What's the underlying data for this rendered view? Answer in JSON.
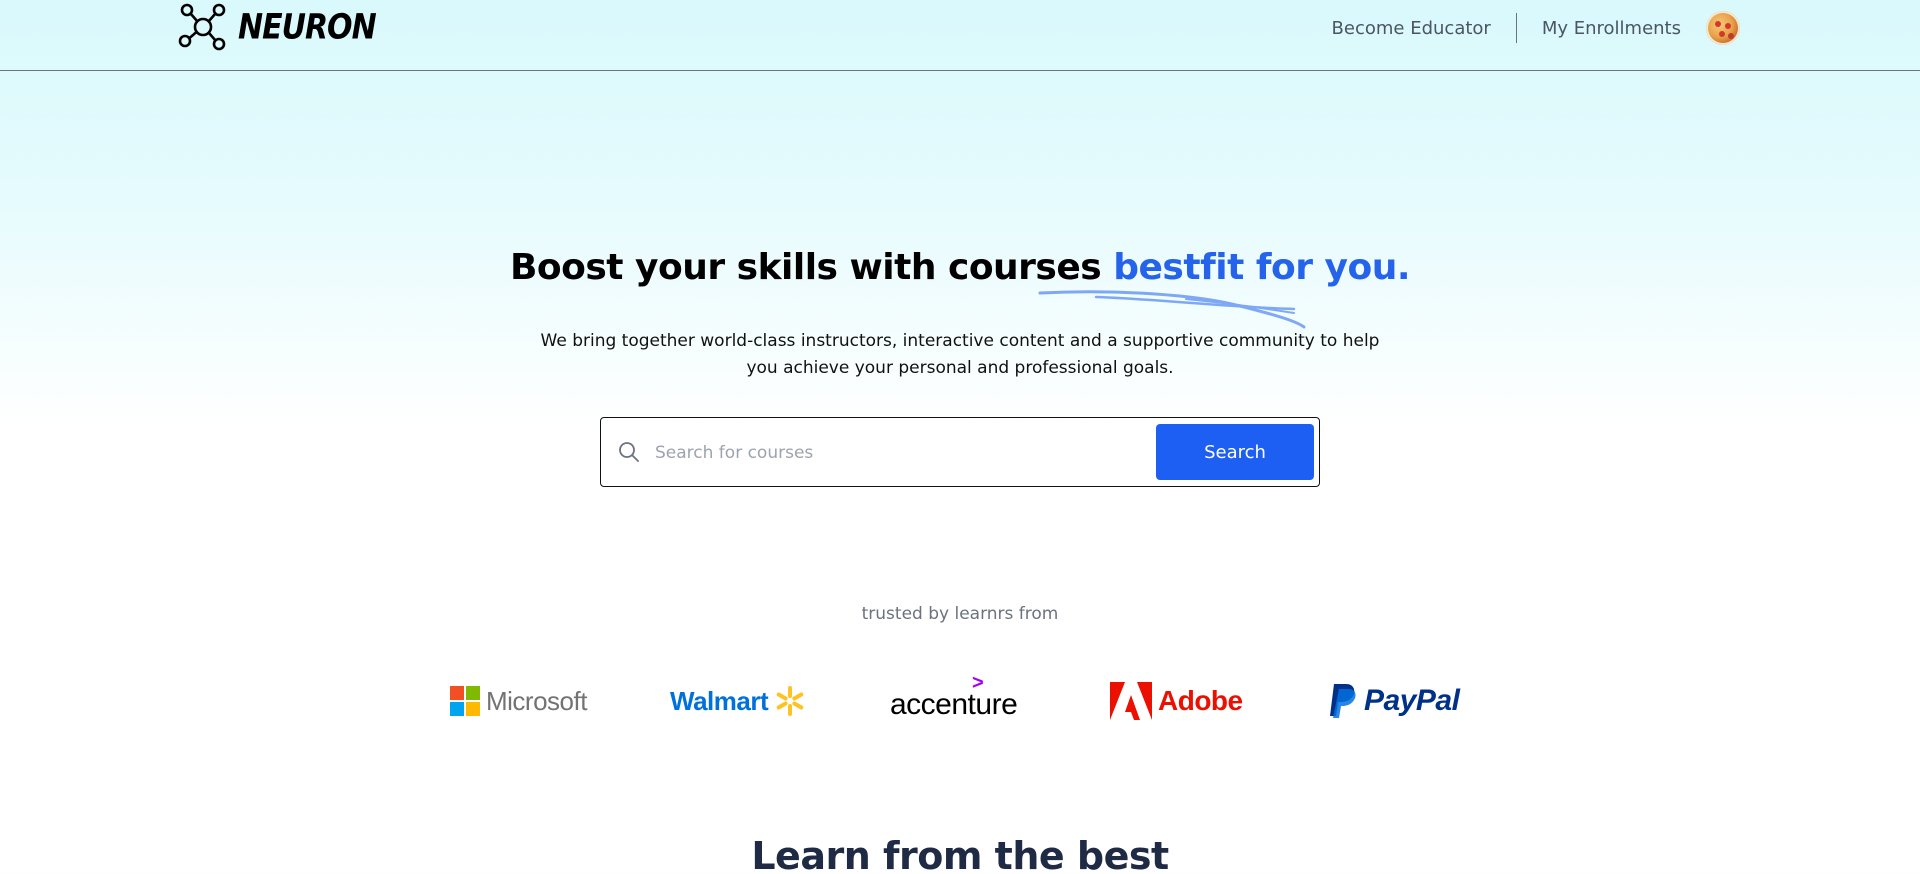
{
  "header": {
    "logo_text": "NEURON",
    "nav": {
      "become_educator": "Become Educator",
      "my_enrollments": "My Enrollments"
    }
  },
  "hero": {
    "title_main": "Boost your skills with courses ",
    "title_accent": "bestfit for you.",
    "subtitle": "We bring together world-class instructors, interactive content and a supportive community to help you achieve your personal and professional goals.",
    "accent_color": "#2563eb"
  },
  "search": {
    "placeholder": "Search for courses",
    "value": "",
    "button_label": "Search",
    "button_color": "#1d5ff2"
  },
  "trusted": {
    "label": "trusted by learnrs from",
    "companies": [
      "Microsoft",
      "Walmart",
      "accenture",
      "Adobe",
      "PayPal"
    ]
  },
  "next_section": {
    "title": "Learn from the best"
  }
}
